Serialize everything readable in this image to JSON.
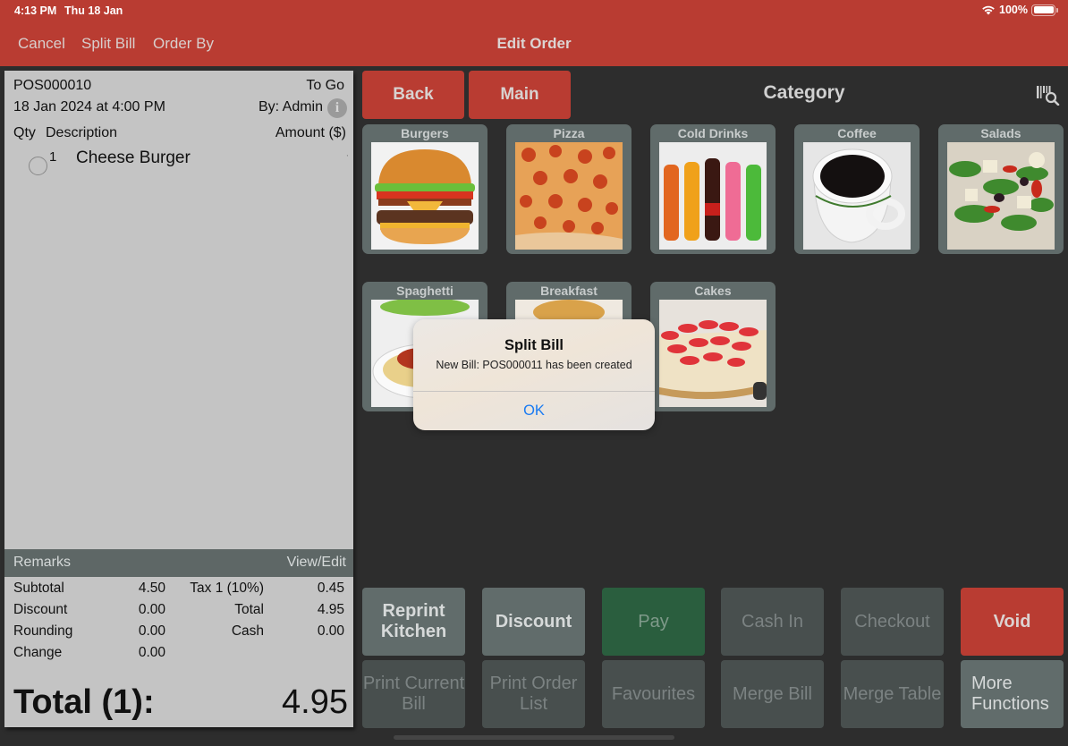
{
  "status_bar": {
    "time": "4:13 PM",
    "date": "Thu 18 Jan",
    "battery": "100%"
  },
  "nav": {
    "title": "Edit Order",
    "left_buttons": [
      "Cancel",
      "Split Bill",
      "Order By"
    ]
  },
  "receipt": {
    "order_no": "POS000010",
    "order_type": "To Go",
    "datetime": "18 Jan 2024 at 4:00 PM",
    "by": "By: Admin",
    "headers": {
      "qty": "Qty",
      "description": "Description",
      "amount": "Amount ($)"
    },
    "items": [
      {
        "qty": "1",
        "description": "Cheese Burger",
        "amount": "'"
      }
    ],
    "remarks_label": "Remarks",
    "remarks_action": "View/Edit",
    "summary": {
      "subtotal_label": "Subtotal",
      "subtotal": "4.50",
      "tax_label": "Tax 1 (10%)",
      "tax": "0.45",
      "discount_label": "Discount",
      "discount": "0.00",
      "total_label": "Total",
      "total": "4.95",
      "rounding_label": "Rounding",
      "rounding": "0.00",
      "cash_label": "Cash",
      "cash": "0.00",
      "change_label": "Change",
      "change": "0.00"
    },
    "grand_total_label": "Total (1):",
    "grand_total": "4.95"
  },
  "category_panel": {
    "back_label": "Back",
    "main_label": "Main",
    "heading": "Category",
    "categories": [
      {
        "label": "Burgers",
        "icon": "burger-image"
      },
      {
        "label": "Pizza",
        "icon": "pizza-image"
      },
      {
        "label": "Cold Drinks",
        "icon": "cold-drinks-image"
      },
      {
        "label": "Coffee",
        "icon": "coffee-image"
      },
      {
        "label": "Salads",
        "icon": "salad-image"
      },
      {
        "label": "Spaghetti",
        "icon": "spaghetti-image"
      },
      {
        "label": "Breakfast",
        "icon": "breakfast-image"
      },
      {
        "label": "Cakes",
        "icon": "cake-image"
      }
    ]
  },
  "actions": {
    "row1": [
      "Reprint Kitchen",
      "Discount",
      "Pay",
      "Cash In",
      "Checkout",
      "Void"
    ],
    "row2": [
      "Print Current Bill",
      "Print Order List",
      "Favourites",
      "Merge Bill",
      "Merge Table",
      "More Functions"
    ]
  },
  "alert": {
    "title": "Split Bill",
    "message": "New Bill: POS000011 has been created",
    "ok_label": "OK"
  },
  "colors": {
    "brand_red": "#b93c32",
    "pay_green": "#2a5e3e",
    "alert_link_blue": "#1a7bf2"
  }
}
